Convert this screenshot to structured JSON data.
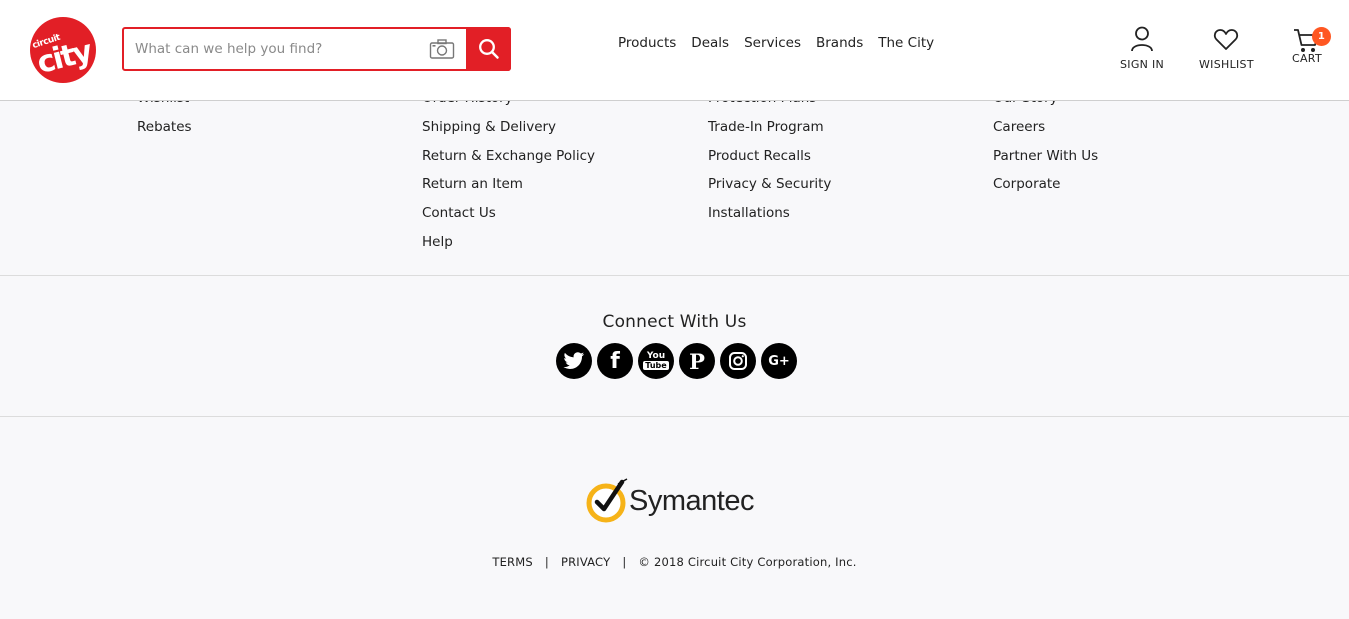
{
  "header": {
    "logo_small": "circuit",
    "logo_big": "city",
    "search_placeholder": "What can we help you find?",
    "nav": [
      "Products",
      "Deals",
      "Services",
      "Brands",
      "The City"
    ],
    "sign_in": "SIGN IN",
    "wishlist": "WISHLIST",
    "cart": "CART",
    "cart_count": "1",
    "brand_color": "#e21f26"
  },
  "footer_links": {
    "col1": [
      "Wishlist",
      "Rebates"
    ],
    "col2": [
      "Order History",
      "Shipping & Delivery",
      "Return & Exchange Policy",
      "Return an Item",
      "Contact Us",
      "Help"
    ],
    "col3": [
      "Protection Plans",
      "Trade-In Program",
      "Product Recalls",
      "Privacy & Security",
      "Installations"
    ],
    "col4": [
      "Our Story",
      "Careers",
      "Partner With Us",
      "Corporate"
    ]
  },
  "connect": {
    "title": "Connect With Us",
    "icons": [
      "twitter-icon",
      "facebook-icon",
      "youtube-icon",
      "pinterest-icon",
      "instagram-icon",
      "google-plus-icon"
    ]
  },
  "bottom": {
    "symantec": "Symantec",
    "terms": "TERMS",
    "privacy": "PRIVACY",
    "copyright": "© 2018 Circuit City Corporation, Inc.",
    "separator": "|"
  }
}
